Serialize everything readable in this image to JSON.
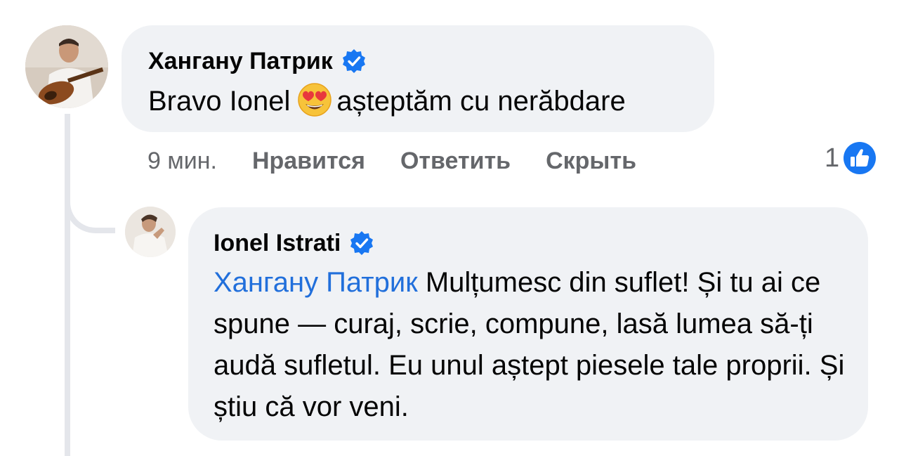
{
  "comment": {
    "author": "Хангану Патрик",
    "text_before": "Bravo Ionel",
    "text_after": "așteptăm cu nerăbdare",
    "emoji": "heart-eyes-emoji",
    "time": "9 мин.",
    "actions": [
      "Нравится",
      "Ответить",
      "Скрыть"
    ],
    "reaction_count": "1",
    "reaction_icon": "like-icon"
  },
  "reply": {
    "author": "Ionel Istrati",
    "mention": "Хангану Патрик",
    "text": " Mulțumesc din suflet! Și tu ai ce spune — curaj, scrie, compune, lasă lumea să-ți audă sufletul. Eu unul aștept piesele tale proprii. Și știu că vor veni."
  },
  "colors": {
    "bubble": "#f0f2f5",
    "verified": "#1877f2",
    "mention": "#216fdb",
    "secondary_text": "#65676b",
    "thread_line": "#e4e6eb"
  }
}
